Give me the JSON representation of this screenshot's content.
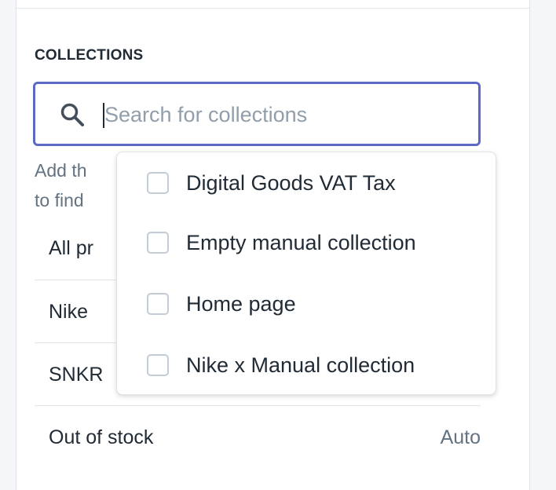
{
  "collections_section": {
    "title": "COLLECTIONS",
    "search": {
      "placeholder": "Search for collections",
      "value": "",
      "icon": "search-icon",
      "focus_color": "#5c6ac4"
    },
    "helper_text_visible": "Add th to find"
  },
  "collections_list": [
    {
      "name": "All pr",
      "type": ""
    },
    {
      "name": "Nike",
      "type": ""
    },
    {
      "name": "SNKR",
      "type": ""
    },
    {
      "name": "Out of stock",
      "type": "Auto"
    }
  ],
  "dropdown": {
    "options": [
      {
        "label": "Digital Goods VAT Tax",
        "checked": false
      },
      {
        "label": "Empty manual collection",
        "checked": false
      },
      {
        "label": "Home page",
        "checked": false
      },
      {
        "label": "Nike x Manual collection",
        "checked": false
      }
    ]
  },
  "colors": {
    "text_primary": "#212b36",
    "text_secondary": "#637381",
    "border": "#dfe3e8"
  }
}
